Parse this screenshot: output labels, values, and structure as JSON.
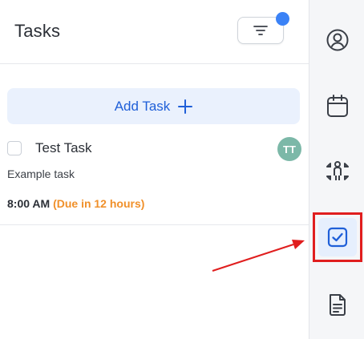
{
  "header": {
    "title": "Tasks",
    "filter_icon": "filter-icon",
    "notification_color": "#3b82f6"
  },
  "add_task": {
    "label": "Add Task",
    "icon": "plus-icon"
  },
  "tasks": [
    {
      "title": "Test Task",
      "description": "Example task",
      "time": "8:00 AM",
      "due": "(Due in 12 hours)",
      "assignee_initials": "TT",
      "completed": false
    }
  ],
  "sidebar": {
    "items": [
      {
        "name": "profile",
        "icon": "user-circle-icon"
      },
      {
        "name": "calendar",
        "icon": "calendar-icon"
      },
      {
        "name": "team",
        "icon": "team-icon"
      },
      {
        "name": "tasks",
        "icon": "check-square-icon",
        "active": true
      },
      {
        "name": "documents",
        "icon": "document-icon"
      }
    ]
  },
  "colors": {
    "accent": "#1f5fd8",
    "due": "#f0902a",
    "highlight": "#e01e1e",
    "avatar": "#7cb8a8"
  }
}
